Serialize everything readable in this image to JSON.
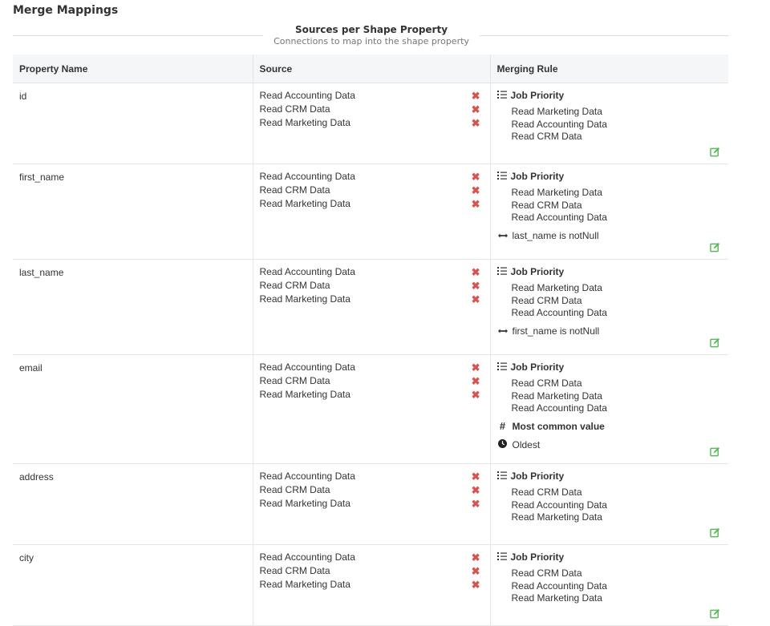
{
  "page": {
    "title": "Merge Mappings"
  },
  "section": {
    "title": "Sources per Shape Property",
    "subtitle": "Connections to map into the shape property"
  },
  "table": {
    "headers": {
      "property": "Property Name",
      "source": "Source",
      "rule": "Merging Rule"
    },
    "rows": [
      {
        "property": "id",
        "sources": [
          "Read Accounting Data",
          "Read CRM Data",
          "Read Marketing Data"
        ],
        "rule_title": "Job Priority",
        "priority": [
          "Read Marketing Data",
          "Read Accounting Data",
          "Read CRM Data"
        ],
        "extras": []
      },
      {
        "property": "first_name",
        "sources": [
          "Read Accounting Data",
          "Read CRM Data",
          "Read Marketing Data"
        ],
        "rule_title": "Job Priority",
        "priority": [
          "Read Marketing Data",
          "Read CRM Data",
          "Read Accounting Data"
        ],
        "extras": [
          {
            "icon": "arrows-horizontal-icon",
            "text": "last_name is notNull",
            "bold": false
          }
        ]
      },
      {
        "property": "last_name",
        "sources": [
          "Read Accounting Data",
          "Read CRM Data",
          "Read Marketing Data"
        ],
        "rule_title": "Job Priority",
        "priority": [
          "Read Marketing Data",
          "Read CRM Data",
          "Read Accounting Data"
        ],
        "extras": [
          {
            "icon": "arrows-horizontal-icon",
            "text": "first_name is notNull",
            "bold": false
          }
        ]
      },
      {
        "property": "email",
        "sources": [
          "Read Accounting Data",
          "Read CRM Data",
          "Read Marketing Data"
        ],
        "rule_title": "Job Priority",
        "priority": [
          "Read CRM Data",
          "Read Marketing Data",
          "Read Accounting Data"
        ],
        "extras": [
          {
            "icon": "hash-icon",
            "text": "Most common value",
            "bold": true
          },
          {
            "icon": "clock-icon",
            "text": "Oldest",
            "bold": false
          }
        ]
      },
      {
        "property": "address",
        "sources": [
          "Read Accounting Data",
          "Read CRM Data",
          "Read Marketing Data"
        ],
        "rule_title": "Job Priority",
        "priority": [
          "Read CRM Data",
          "Read Accounting Data",
          "Read Marketing Data"
        ],
        "extras": []
      },
      {
        "property": "city",
        "sources": [
          "Read Accounting Data",
          "Read CRM Data",
          "Read Marketing Data"
        ],
        "rule_title": "Job Priority",
        "priority": [
          "Read CRM Data",
          "Read Accounting Data",
          "Read Marketing Data"
        ],
        "extras": []
      }
    ]
  },
  "icons": {
    "remove": "remove-icon",
    "edit": "edit-icon",
    "rule": "list-icon"
  },
  "colors": {
    "remove": "#d9534f",
    "edit": "#5cb85c",
    "header_bg": "#f4f6f8"
  }
}
